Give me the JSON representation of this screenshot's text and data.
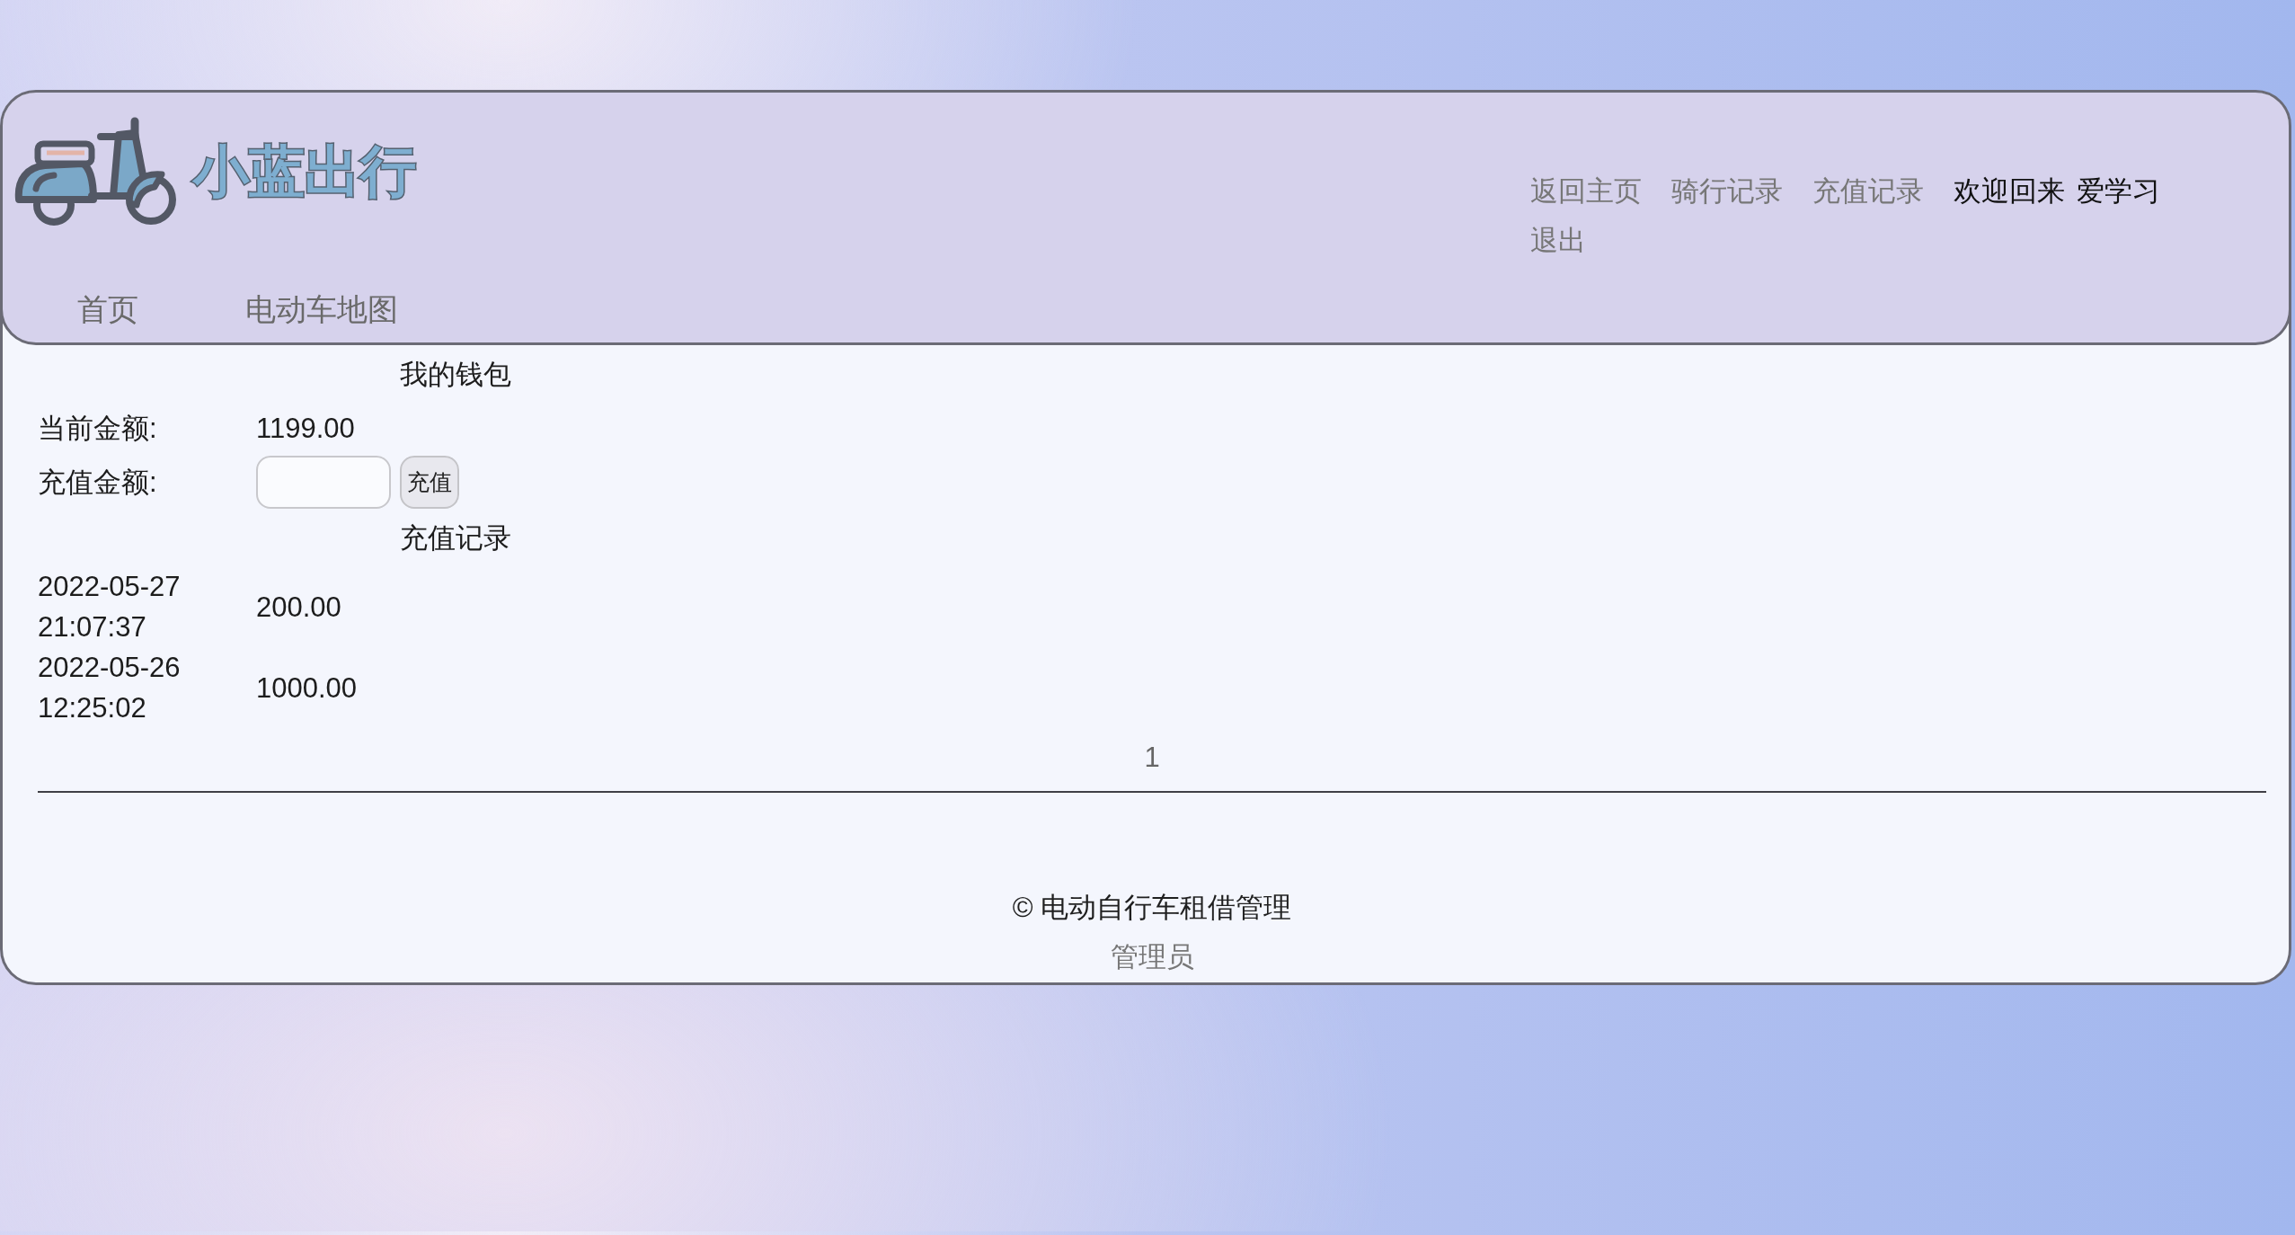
{
  "header": {
    "logo_text": "小蓝出行",
    "nav": [
      {
        "label": "首页"
      },
      {
        "label": "电动车地图"
      }
    ],
    "user_links": [
      {
        "kind": "link",
        "label": "返回主页"
      },
      {
        "kind": "link",
        "label": "骑行记录"
      },
      {
        "kind": "link",
        "label": "充值记录"
      },
      {
        "kind": "greeting",
        "label": "欢迎回来",
        "username": "爱学习"
      },
      {
        "kind": "link",
        "label": "退出"
      }
    ]
  },
  "wallet": {
    "title": "我的钱包",
    "balance_label": "当前金额:",
    "balance": "1199.00",
    "recharge_label": "充值金额:",
    "recharge_button": "充值"
  },
  "records": {
    "title": "充值记录",
    "rows": [
      {
        "time": "2022-05-27 21:07:37",
        "amount": "200.00"
      },
      {
        "time": "2022-05-26 12:25:02",
        "amount": "1000.00"
      }
    ]
  },
  "pagination": {
    "pages": [
      "1"
    ]
  },
  "footer": {
    "copyright": "© 电动自行车租借管理",
    "admin_link": "管理员"
  }
}
